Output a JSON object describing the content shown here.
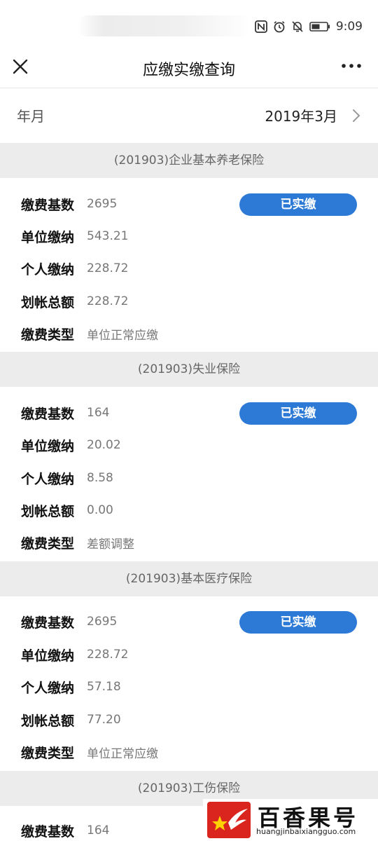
{
  "status": {
    "time": "9:09"
  },
  "nav": {
    "title": "应缴实缴查询"
  },
  "month": {
    "label": "年月",
    "value": "2019年3月"
  },
  "sections": [
    {
      "title": "(201903)企业基本养老保险",
      "badge": "已实缴",
      "fields": [
        {
          "label": "缴费基数",
          "value": "2695"
        },
        {
          "label": "单位缴纳",
          "value": "543.21"
        },
        {
          "label": "个人缴纳",
          "value": "228.72"
        },
        {
          "label": "划帐总额",
          "value": "228.72"
        },
        {
          "label": "缴费类型",
          "value": "单位正常应缴"
        }
      ]
    },
    {
      "title": "(201903)失业保险",
      "badge": "已实缴",
      "fields": [
        {
          "label": "缴费基数",
          "value": "164"
        },
        {
          "label": "单位缴纳",
          "value": "20.02"
        },
        {
          "label": "个人缴纳",
          "value": "8.58"
        },
        {
          "label": "划帐总额",
          "value": "0.00"
        },
        {
          "label": "缴费类型",
          "value": "差额调整"
        }
      ]
    },
    {
      "title": "(201903)基本医疗保险",
      "badge": "已实缴",
      "fields": [
        {
          "label": "缴费基数",
          "value": "2695"
        },
        {
          "label": "单位缴纳",
          "value": "228.72"
        },
        {
          "label": "个人缴纳",
          "value": "57.18"
        },
        {
          "label": "划帐总额",
          "value": "77.20"
        },
        {
          "label": "缴费类型",
          "value": "单位正常应缴"
        }
      ]
    },
    {
      "title": "(201903)工伤保险",
      "fields": [
        {
          "label": "缴费基数",
          "value": "164"
        }
      ]
    }
  ],
  "watermark": {
    "text": "百香果号",
    "url": "huangjinbaixiangguo.com"
  },
  "colors": {
    "accent": "#2d7ad6",
    "section_bg": "#ececec",
    "watermark_red": "#d9251d"
  }
}
